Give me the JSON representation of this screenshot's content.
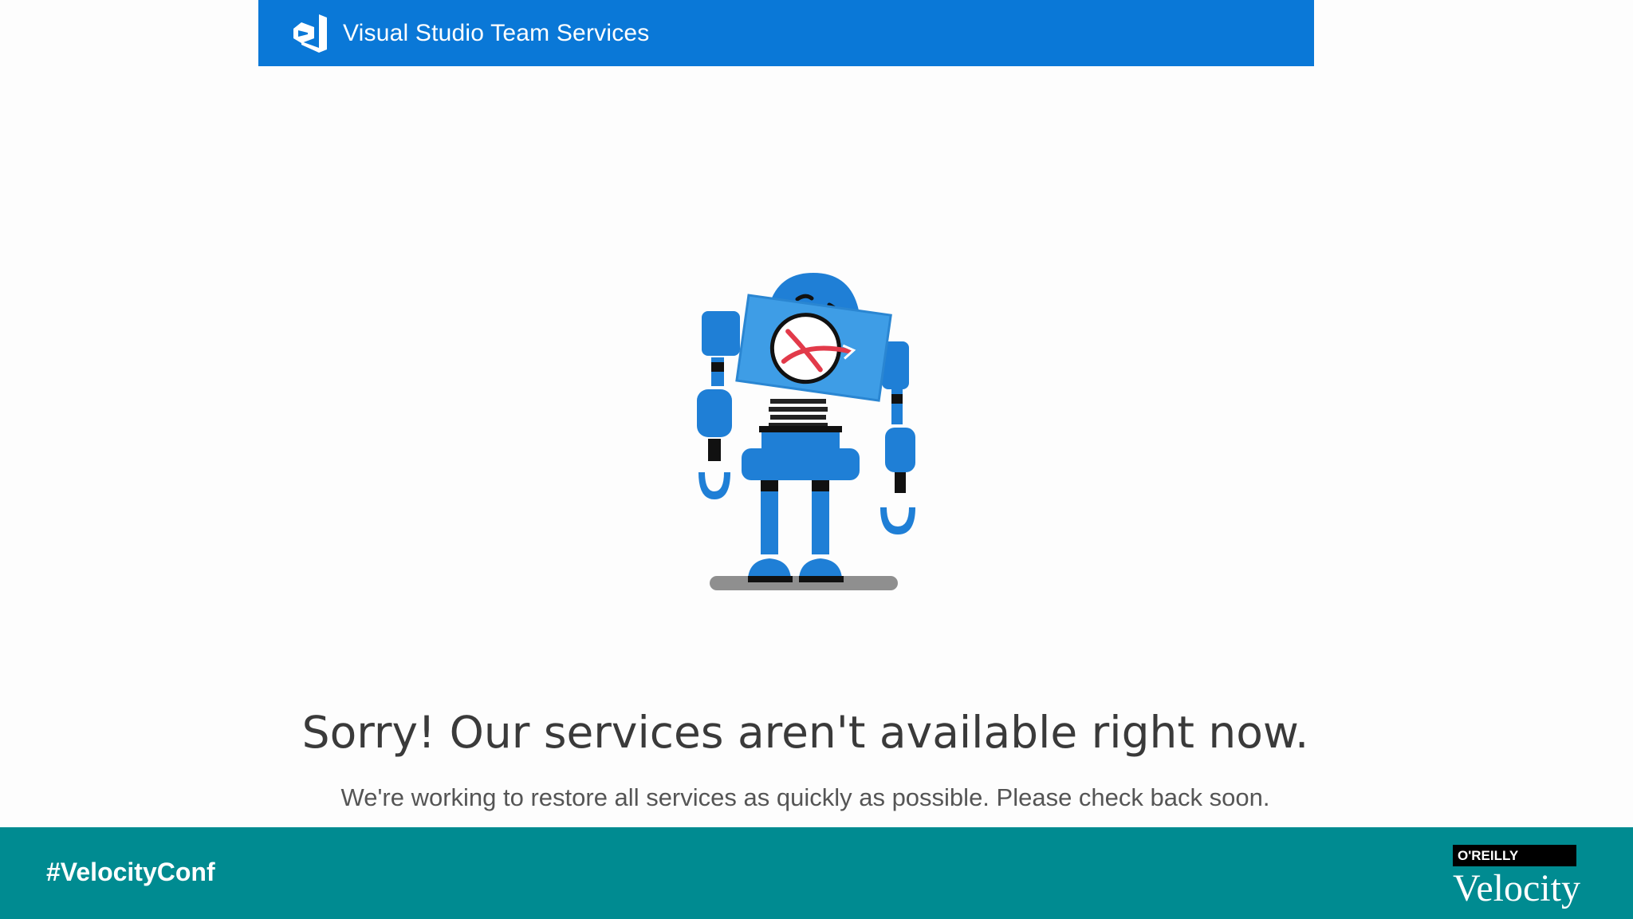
{
  "header": {
    "app_title": "Visual Studio Team Services",
    "logo_icon": "visual-studio-logo-icon",
    "background": "#0a78d7"
  },
  "main": {
    "illustration_icon": "broken-robot-icon",
    "error_title": "Sorry! Our services aren't available right now.",
    "error_message": "We're working to restore all services as quickly as possible. Please check back soon."
  },
  "footer": {
    "hashtag": "#VelocityConf",
    "publisher": "O'REILLY",
    "conference": "Velocity",
    "background": "#008b91"
  }
}
